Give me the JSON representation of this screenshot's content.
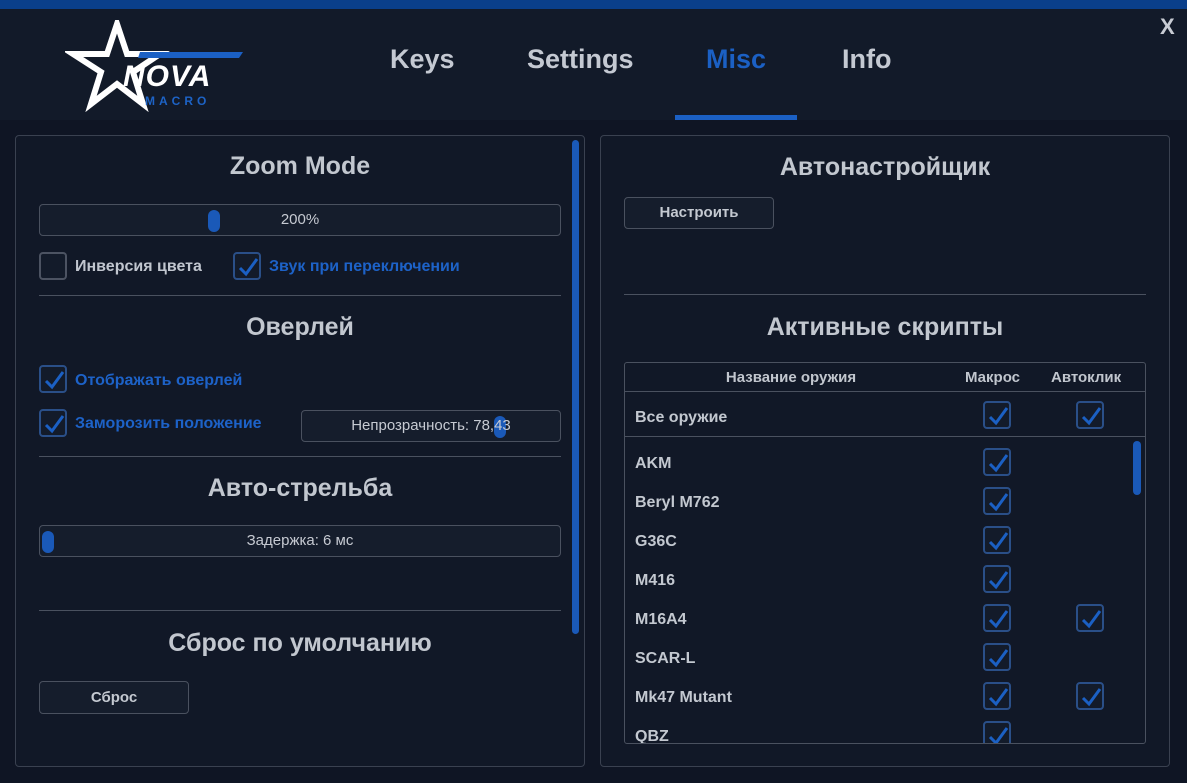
{
  "window": {
    "close_label": "X"
  },
  "logo": {
    "nova": "NOVA",
    "macro": "MACRO"
  },
  "nav": {
    "tabs": [
      "Keys",
      "Settings",
      "Misc",
      "Info"
    ],
    "active": "Misc"
  },
  "left_panel": {
    "zoom": {
      "title": "Zoom Mode",
      "slider_text": "200%",
      "slider_fraction": 0.33
    },
    "invert_color": {
      "label": "Инверсия цвета",
      "checked": false
    },
    "switch_sound": {
      "label": "Звук при переключении",
      "checked": true
    },
    "overlay": {
      "title": "Оверлей",
      "show_overlay": {
        "label": "Отображать оверлей",
        "checked": true
      },
      "freeze_position": {
        "label": "Заморозить положение",
        "checked": true
      },
      "opacity_slider_text": "Непрозрачность: 78,43",
      "opacity_fraction": 0.7843
    },
    "autofire": {
      "title": "Авто-стрельба",
      "slider_text": "Задержка: 6 мс",
      "slider_fraction": 0.0
    },
    "reset": {
      "title": "Сброс по умолчанию",
      "button_label": "Сброс"
    }
  },
  "right_panel": {
    "autotuner": {
      "title": "Автонастройщик",
      "button_label": "Настроить"
    },
    "scripts": {
      "title": "Активные скрипты",
      "headers": {
        "name": "Название оружия",
        "macro": "Макрос",
        "autoclick": "Автоклик"
      },
      "all_weapons": {
        "name": "Все оружие",
        "macro": true,
        "autoclick": true
      },
      "rows": [
        {
          "name": "AKM",
          "macro": true,
          "autoclick": false
        },
        {
          "name": "Beryl M762",
          "macro": true,
          "autoclick": false
        },
        {
          "name": "G36C",
          "macro": true,
          "autoclick": false
        },
        {
          "name": "M416",
          "macro": true,
          "autoclick": false
        },
        {
          "name": "M16A4",
          "macro": true,
          "autoclick": true
        },
        {
          "name": "SCAR-L",
          "macro": true,
          "autoclick": false
        },
        {
          "name": "Mk47 Mutant",
          "macro": true,
          "autoclick": true
        },
        {
          "name": "QBZ",
          "macro": true,
          "autoclick": false
        }
      ]
    }
  },
  "colors": {
    "accent": "#1b60c4",
    "background": "#0f1524",
    "panel_border": "#3a4150"
  }
}
